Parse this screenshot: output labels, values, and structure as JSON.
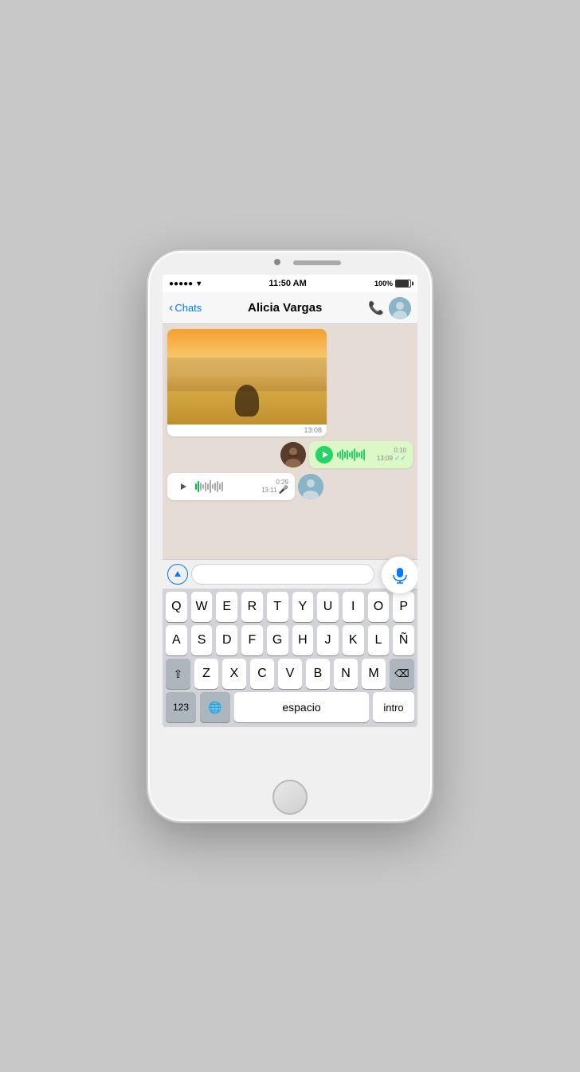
{
  "phone": {
    "status_bar": {
      "signal": "●●●●●",
      "wifi": "wifi",
      "time": "11:50 AM",
      "battery": "100%"
    },
    "nav": {
      "back_label": "Chats",
      "title": "Alicia Vargas"
    },
    "messages": [
      {
        "type": "image",
        "time": "13:08",
        "direction": "received"
      },
      {
        "type": "voice",
        "duration": "0:10",
        "time": "13:09",
        "direction": "received",
        "ticks": "✓✓"
      },
      {
        "type": "voice",
        "duration": "0:29",
        "time": "13:11",
        "direction": "sent"
      }
    ],
    "input": {
      "placeholder": ""
    },
    "keyboard": {
      "rows": [
        [
          "Q",
          "W",
          "E",
          "R",
          "T",
          "Y",
          "U",
          "I",
          "O",
          "P"
        ],
        [
          "A",
          "S",
          "D",
          "F",
          "G",
          "H",
          "J",
          "K",
          "L",
          "Ñ"
        ],
        [
          "Z",
          "X",
          "C",
          "V",
          "B",
          "N",
          "M"
        ],
        [
          "123",
          "🌐",
          "espacio",
          "intro"
        ]
      ],
      "dots_label": "⋮",
      "shift_label": "⇧",
      "delete_label": "⌫"
    }
  }
}
